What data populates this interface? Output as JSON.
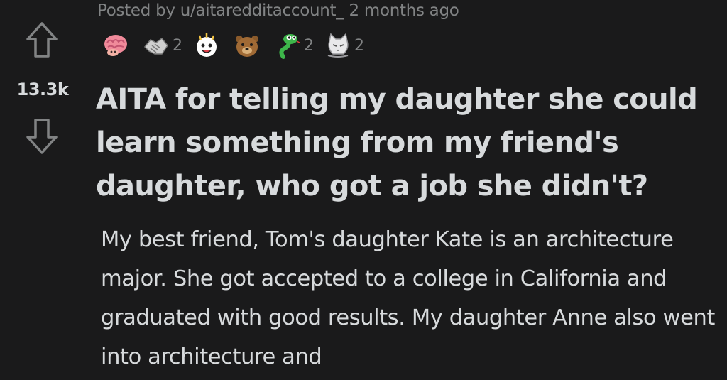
{
  "post": {
    "meta": {
      "posted_by_prefix": "Posted by",
      "username": "u/aitaredditaccount_",
      "age": "2 months ago"
    },
    "score": "13.3k",
    "awards": [
      {
        "name": "brain-award",
        "count": ""
      },
      {
        "name": "handshake-award",
        "count": "2"
      },
      {
        "name": "wholesome-award",
        "count": ""
      },
      {
        "name": "bear-award",
        "count": ""
      },
      {
        "name": "snek-award",
        "count": "2"
      },
      {
        "name": "cat-award",
        "count": "2"
      }
    ],
    "title": "AITA for telling my daughter she could learn something from my friend's daughter, who got a job she didn't?",
    "body": "My best friend, Tom's daughter Kate is an architecture major. She got accepted to a college in California and graduated with good results. My daughter Anne also went into architecture and"
  },
  "colors": {
    "background": "#1a1a1b",
    "text": "#d7dadc",
    "meta_text": "#818384",
    "icon_outline": "#818384"
  }
}
